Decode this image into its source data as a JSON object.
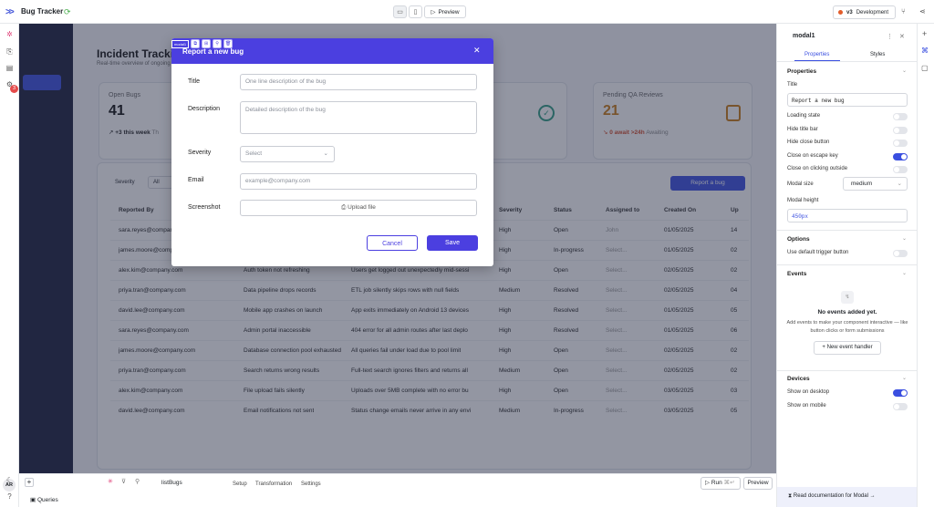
{
  "topbar": {
    "app_name": "Bug Tracker",
    "preview_label": "Preview",
    "version": "v3",
    "environment": "Development"
  },
  "rail": {
    "notification_count": "3",
    "avatar_initials": "AR"
  },
  "app": {
    "title": "Incident Tracking",
    "subtitle": "Real-time overview of ongoing",
    "cards": [
      {
        "label": "Open Bugs",
        "value": "41",
        "trend": "+3 this week",
        "trend_note": "Th"
      },
      {
        "label": "Pending QA Reviews",
        "value": "21",
        "trend": "0 await >24h",
        "trend_note": "Awaiting"
      }
    ],
    "filter_label": "Severity",
    "filter_value": "All",
    "report_button": "Report a bug",
    "columns": [
      "Reported By",
      "Severity",
      "Status",
      "Assigned to",
      "Created On",
      "Up"
    ],
    "rows": [
      {
        "reporter": "sara.reyes@company.com",
        "title": "",
        "desc": "",
        "severity": "High",
        "status": "Open",
        "assignee": "John",
        "created": "01/05/2025",
        "up": "14"
      },
      {
        "reporter": "james.moore@company.com",
        "title": "",
        "desc": "",
        "severity": "High",
        "status": "In-progress",
        "assignee": "Select...",
        "created": "01/05/2025",
        "up": "02"
      },
      {
        "reporter": "alex.kim@company.com",
        "title": "Auth token not refreshing",
        "desc": "Users get logged out unexpectedly mid-sessi",
        "severity": "High",
        "status": "Open",
        "assignee": "Select...",
        "created": "02/05/2025",
        "up": "02"
      },
      {
        "reporter": "priya.tran@company.com",
        "title": "Data pipeline drops records",
        "desc": "ETL job silently skips rows with null fields",
        "severity": "Medium",
        "status": "Resolved",
        "assignee": "Select...",
        "created": "02/05/2025",
        "up": "04"
      },
      {
        "reporter": "david.lee@company.com",
        "title": "Mobile app crashes on launch",
        "desc": "App exits immediately on Android 13 devices",
        "severity": "High",
        "status": "Resolved",
        "assignee": "Select...",
        "created": "01/05/2025",
        "up": "05"
      },
      {
        "reporter": "sara.reyes@company.com",
        "title": "Admin portal inaccessible",
        "desc": "404 error for all admin routes after last deplo",
        "severity": "High",
        "status": "Resolved",
        "assignee": "Select...",
        "created": "01/05/2025",
        "up": "06"
      },
      {
        "reporter": "james.moore@company.com",
        "title": "Database connection pool exhausted",
        "desc": "All queries fail under load due to pool limit",
        "severity": "High",
        "status": "Open",
        "assignee": "Select...",
        "created": "02/05/2025",
        "up": "02"
      },
      {
        "reporter": "priya.tran@company.com",
        "title": "Search returns wrong results",
        "desc": "Full-text search ignores filters and returns all",
        "severity": "Medium",
        "status": "Open",
        "assignee": "Select...",
        "created": "02/05/2025",
        "up": "02"
      },
      {
        "reporter": "alex.kim@company.com",
        "title": "File upload fails silently",
        "desc": "Uploads over 5MB complete with no error bu",
        "severity": "High",
        "status": "Open",
        "assignee": "Select...",
        "created": "03/05/2025",
        "up": "03"
      },
      {
        "reporter": "david.lee@company.com",
        "title": "Email notifications not sent",
        "desc": "Status change emails never arrive in any envi",
        "severity": "Medium",
        "status": "In-progress",
        "assignee": "Select...",
        "created": "03/05/2025",
        "up": "05"
      }
    ]
  },
  "modal": {
    "tag": "modal1",
    "title": "Report a new bug",
    "fields": {
      "title_label": "Title",
      "title_placeholder": "One line description of the bug",
      "desc_label": "Description",
      "desc_placeholder": "Detailed description of the bug",
      "severity_label": "Severity",
      "severity_placeholder": "Select",
      "email_label": "Email",
      "email_placeholder": "example@company.com",
      "screenshot_label": "Screenshot",
      "upload_label": "Upload file"
    },
    "cancel": "Cancel",
    "save": "Save"
  },
  "querybar": {
    "query_name": "listBugs",
    "tabs": [
      "Setup",
      "Transformation",
      "Settings"
    ],
    "run": "Run",
    "run_shortcut": "⌘↵",
    "preview": "Preview",
    "queries_label": "Queries"
  },
  "panel": {
    "component": "modal1",
    "tab_properties": "Properties",
    "tab_styles": "Styles",
    "sec_properties": "Properties",
    "title_label": "Title",
    "title_value": "Report a new bug",
    "loading_state": "Loading state",
    "hide_title_bar": "Hide title bar",
    "hide_close_button": "Hide close button",
    "close_on_escape": "Close on escape key",
    "close_outside": "Close on clicking outside",
    "modal_size_label": "Modal size",
    "modal_size_value": "medium",
    "modal_height_label": "Modal height",
    "modal_height_value": "450px",
    "sec_options": "Options",
    "use_default_trigger": "Use default trigger button",
    "sec_events": "Events",
    "no_events": "No events added yet.",
    "events_help": "Add events to make your component interactive — like button clicks or form submissions",
    "new_event": "New event handler",
    "sec_devices": "Devices",
    "show_desktop": "Show on desktop",
    "show_mobile": "Show on mobile",
    "docs_link": "Read documentation for Modal →"
  }
}
